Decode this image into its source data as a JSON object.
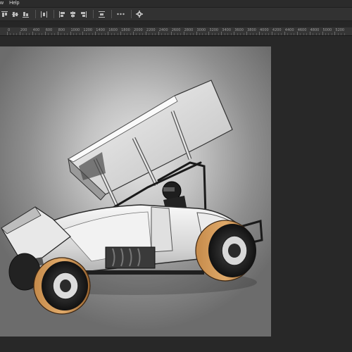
{
  "menubar": {
    "items": [
      "w",
      "Help"
    ]
  },
  "ruler": {
    "labels": [
      "0",
      "200",
      "400",
      "600",
      "800",
      "1000",
      "1200",
      "1400",
      "1600",
      "1800",
      "2000",
      "2200",
      "2400",
      "2600",
      "2800",
      "3000",
      "3200",
      "3400",
      "3600",
      "3800",
      "4000",
      "4200",
      "4400",
      "4600",
      "4800",
      "5000",
      "5200"
    ]
  },
  "toolbar": {
    "icons": [
      "align-top-edges-icon",
      "align-vertical-centers-icon",
      "align-bottom-edges-icon",
      "distribute-horizontal-icon",
      "align-left-edges-icon",
      "align-horizontal-centers-icon",
      "align-right-edges-icon",
      "distribute-vertical-icon",
      "more-options-icon",
      "settings-gear-icon"
    ]
  },
  "canvas": {
    "subject": "sprint-car-illustration"
  },
  "colors": {
    "canvas_center": "#e7e7e7",
    "canvas_edge": "#6c6c6c",
    "workspace": "#282828",
    "panel": "#323232"
  }
}
